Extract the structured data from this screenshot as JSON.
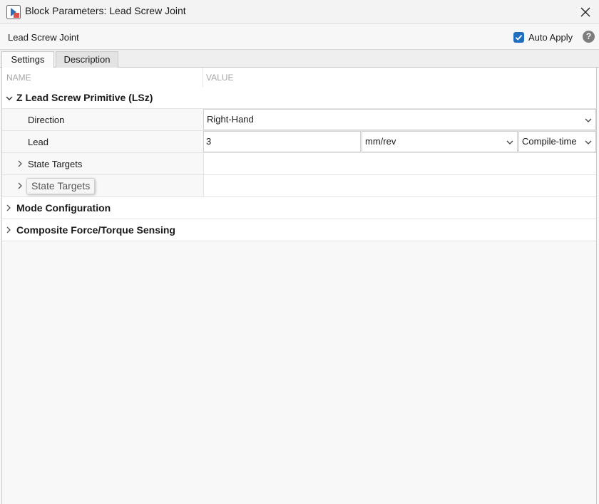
{
  "window": {
    "title": "Block Parameters: Lead Screw Joint",
    "icon": "simulink-block-icon",
    "close_icon": "close-icon"
  },
  "header": {
    "block_name": "Lead Screw Joint",
    "auto_apply_label": "Auto Apply",
    "auto_apply_checked": true,
    "help_symbol": "?"
  },
  "tabs": [
    {
      "label": "Settings",
      "active": true
    },
    {
      "label": "Description",
      "active": false
    }
  ],
  "columns": {
    "name": "NAME",
    "value": "VALUE"
  },
  "sections": [
    {
      "label": "Z Lead Screw Primitive (LSz)",
      "expanded": true,
      "params": [
        {
          "name": "Direction",
          "value": "Right-Hand"
        },
        {
          "name": "Lead",
          "value": "3",
          "unit": "mm/rev",
          "evaluation": "Compile-time"
        },
        {
          "name": "State Targets"
        },
        {
          "name": "State Targets",
          "tooltip": "State Targets"
        }
      ]
    },
    {
      "label": "Mode Configuration",
      "expanded": false
    },
    {
      "label": "Composite Force/Torque Sensing",
      "expanded": false
    }
  ],
  "colors": {
    "accent": "#1f6fbf",
    "help": "#7d7d7d"
  }
}
